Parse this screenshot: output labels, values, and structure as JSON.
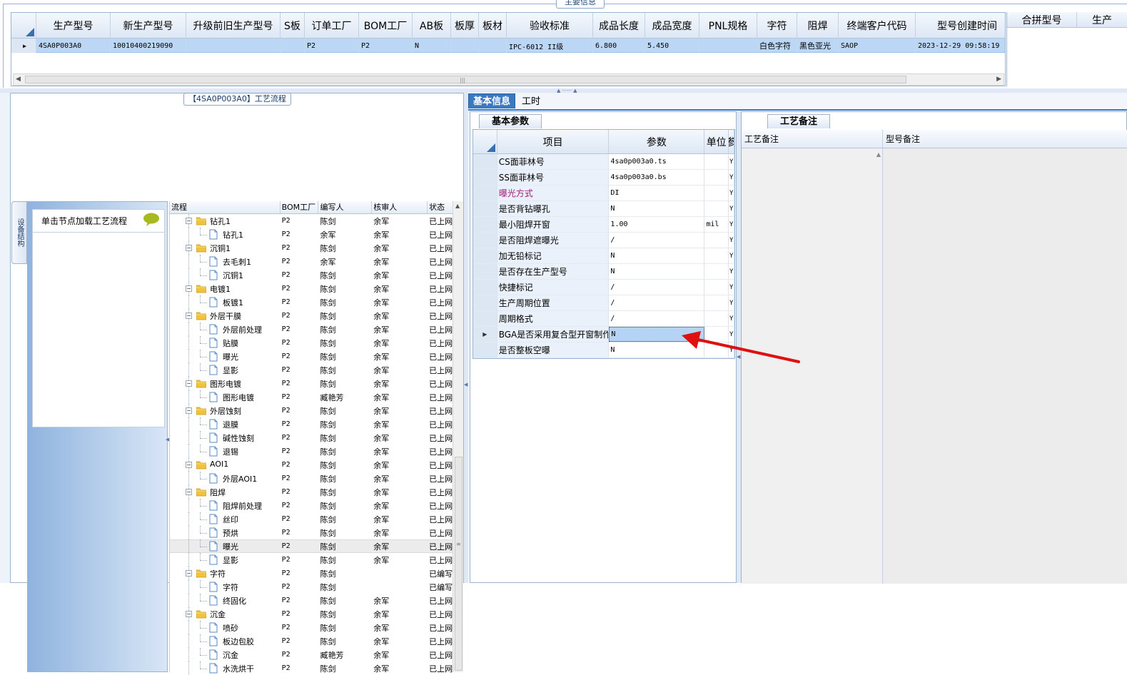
{
  "top": {
    "title": "主要信息",
    "columns": [
      "生产型号",
      "新生产型号",
      "升级前旧生产型号",
      "S板",
      "订单工厂",
      "BOM工厂",
      "AB板",
      "板厚",
      "板材",
      "验收标准",
      "成品长度",
      "成品宽度",
      "PNL规格",
      "字符",
      "阻焊",
      "终端客户代码",
      "型号创建时间"
    ],
    "row": [
      "4SA0P003A0",
      "10010400219090",
      "",
      "",
      "P2",
      "P2",
      "N",
      "",
      "",
      "IPC-6012 II级",
      "6.800",
      "5.450",
      "",
      "白色字符",
      "黑色亚光",
      "SAOP",
      "2023-12-29 09:58:19"
    ],
    "side_columns": [
      "合拼型号",
      "生产"
    ]
  },
  "process": {
    "title": "【4SA0P003A0】工艺流程",
    "vtab_label": "设备结构",
    "node_hint": "单击节点加载工艺流程",
    "headers": [
      "流程",
      "BOM工厂",
      "编写人",
      "核审人",
      "状态"
    ],
    "rows": [
      {
        "name": "钻孔1",
        "level": 0,
        "folder": true,
        "bom": "P2",
        "writer": "陈剑",
        "reviewer": "余军",
        "status": "已上网"
      },
      {
        "name": "钻孔1",
        "level": 1,
        "folder": false,
        "bom": "P2",
        "writer": "余军",
        "reviewer": "余军",
        "status": "已上网"
      },
      {
        "name": "沉铜1",
        "level": 0,
        "folder": true,
        "bom": "P2",
        "writer": "陈剑",
        "reviewer": "余军",
        "status": "已上网"
      },
      {
        "name": "去毛刺1",
        "level": 1,
        "folder": false,
        "bom": "P2",
        "writer": "余军",
        "reviewer": "余军",
        "status": "已上网"
      },
      {
        "name": "沉铜1",
        "level": 1,
        "folder": false,
        "bom": "P2",
        "writer": "陈剑",
        "reviewer": "余军",
        "status": "已上网"
      },
      {
        "name": "电镀1",
        "level": 0,
        "folder": true,
        "bom": "P2",
        "writer": "陈剑",
        "reviewer": "余军",
        "status": "已上网"
      },
      {
        "name": "板镀1",
        "level": 1,
        "folder": false,
        "bom": "P2",
        "writer": "陈剑",
        "reviewer": "余军",
        "status": "已上网"
      },
      {
        "name": "外层干膜",
        "level": 0,
        "folder": true,
        "bom": "P2",
        "writer": "陈剑",
        "reviewer": "余军",
        "status": "已上网"
      },
      {
        "name": "外层前处理",
        "level": 1,
        "folder": false,
        "bom": "P2",
        "writer": "陈剑",
        "reviewer": "余军",
        "status": "已上网"
      },
      {
        "name": "贴膜",
        "level": 1,
        "folder": false,
        "bom": "P2",
        "writer": "陈剑",
        "reviewer": "余军",
        "status": "已上网"
      },
      {
        "name": "曝光",
        "level": 1,
        "folder": false,
        "bom": "P2",
        "writer": "陈剑",
        "reviewer": "余军",
        "status": "已上网"
      },
      {
        "name": "显影",
        "level": 1,
        "folder": false,
        "bom": "P2",
        "writer": "陈剑",
        "reviewer": "余军",
        "status": "已上网"
      },
      {
        "name": "图形电镀",
        "level": 0,
        "folder": true,
        "bom": "P2",
        "writer": "陈剑",
        "reviewer": "余军",
        "status": "已上网"
      },
      {
        "name": "图形电镀",
        "level": 1,
        "folder": false,
        "bom": "P2",
        "writer": "臧艳芳",
        "reviewer": "余军",
        "status": "已上网"
      },
      {
        "name": "外层蚀刻",
        "level": 0,
        "folder": true,
        "bom": "P2",
        "writer": "陈剑",
        "reviewer": "余军",
        "status": "已上网"
      },
      {
        "name": "退膜",
        "level": 1,
        "folder": false,
        "bom": "P2",
        "writer": "陈剑",
        "reviewer": "余军",
        "status": "已上网"
      },
      {
        "name": "碱性蚀刻",
        "level": 1,
        "folder": false,
        "bom": "P2",
        "writer": "陈剑",
        "reviewer": "余军",
        "status": "已上网"
      },
      {
        "name": "退锡",
        "level": 1,
        "folder": false,
        "bom": "P2",
        "writer": "陈剑",
        "reviewer": "余军",
        "status": "已上网"
      },
      {
        "name": "AOI1",
        "level": 0,
        "folder": true,
        "bom": "P2",
        "writer": "陈剑",
        "reviewer": "余军",
        "status": "已上网"
      },
      {
        "name": "外层AOI1",
        "level": 1,
        "folder": false,
        "bom": "P2",
        "writer": "陈剑",
        "reviewer": "余军",
        "status": "已上网"
      },
      {
        "name": "阻焊",
        "level": 0,
        "folder": true,
        "bom": "P2",
        "writer": "陈剑",
        "reviewer": "余军",
        "status": "已上网"
      },
      {
        "name": "阻焊前处理",
        "level": 1,
        "folder": false,
        "bom": "P2",
        "writer": "陈剑",
        "reviewer": "余军",
        "status": "已上网"
      },
      {
        "name": "丝印",
        "level": 1,
        "folder": false,
        "bom": "P2",
        "writer": "陈剑",
        "reviewer": "余军",
        "status": "已上网"
      },
      {
        "name": "预烘",
        "level": 1,
        "folder": false,
        "bom": "P2",
        "writer": "陈剑",
        "reviewer": "余军",
        "status": "已上网"
      },
      {
        "name": "曝光",
        "level": 1,
        "folder": false,
        "bom": "P2",
        "writer": "陈剑",
        "reviewer": "余军",
        "status": "已上网",
        "selected": true
      },
      {
        "name": "显影",
        "level": 1,
        "folder": false,
        "bom": "P2",
        "writer": "陈剑",
        "reviewer": "余军",
        "status": "已上网"
      },
      {
        "name": "字符",
        "level": 0,
        "folder": true,
        "bom": "P2",
        "writer": "陈剑",
        "reviewer": "",
        "status": "已编写"
      },
      {
        "name": "字符",
        "level": 1,
        "folder": false,
        "bom": "P2",
        "writer": "陈剑",
        "reviewer": "",
        "status": "已编写"
      },
      {
        "name": "终固化",
        "level": 1,
        "folder": false,
        "bom": "P2",
        "writer": "陈剑",
        "reviewer": "余军",
        "status": "已上网"
      },
      {
        "name": "沉金",
        "level": 0,
        "folder": true,
        "bom": "P2",
        "writer": "陈剑",
        "reviewer": "余军",
        "status": "已上网"
      },
      {
        "name": "喷砂",
        "level": 1,
        "folder": false,
        "bom": "P2",
        "writer": "陈剑",
        "reviewer": "余军",
        "status": "已上网"
      },
      {
        "name": "板边包胶",
        "level": 1,
        "folder": false,
        "bom": "P2",
        "writer": "陈剑",
        "reviewer": "余军",
        "status": "已上网"
      },
      {
        "name": "沉金",
        "level": 1,
        "folder": false,
        "bom": "P2",
        "writer": "臧艳芳",
        "reviewer": "余军",
        "status": "已上网"
      },
      {
        "name": "水洗烘干",
        "level": 1,
        "folder": false,
        "bom": "P2",
        "writer": "陈剑",
        "reviewer": "余军",
        "status": "已上网"
      }
    ]
  },
  "tabs": [
    "基本信息",
    "工时"
  ],
  "basic": {
    "title": "基本参数",
    "headers": [
      "项目",
      "参数",
      "单位",
      "参"
    ],
    "rows": [
      {
        "item": "CS面菲林号",
        "value": "4sa0p003a0.ts",
        "unit": "",
        "flag": "Y"
      },
      {
        "item": "SS面菲林号",
        "value": "4sa0p003a0.bs",
        "unit": "",
        "flag": "Y"
      },
      {
        "item": "曝光方式",
        "value": "DI",
        "unit": "",
        "flag": "Y",
        "highlight": true
      },
      {
        "item": "是否背钻曝孔",
        "value": "N",
        "unit": "",
        "flag": "Y"
      },
      {
        "item": "最小阻焊开窗",
        "value": "1.00",
        "unit": "mil",
        "flag": "Y"
      },
      {
        "item": "是否阻焊遮曝光",
        "value": "/",
        "unit": "",
        "flag": "Y"
      },
      {
        "item": "加无铅标记",
        "value": "N",
        "unit": "",
        "flag": "Y"
      },
      {
        "item": "是否存在生产型号",
        "value": "N",
        "unit": "",
        "flag": "Y"
      },
      {
        "item": "快捷标记",
        "value": "/",
        "unit": "",
        "flag": "Y"
      },
      {
        "item": "生产周期位置",
        "value": "/",
        "unit": "",
        "flag": "Y"
      },
      {
        "item": "周期格式",
        "value": "/",
        "unit": "",
        "flag": "Y"
      },
      {
        "item": "BGA是否采用复合型开窗制作",
        "value": "N",
        "unit": "",
        "flag": "Y",
        "current": true
      },
      {
        "item": "是否整板空曝",
        "value": "N",
        "unit": "",
        "flag": "Y"
      }
    ]
  },
  "remark": {
    "title": "工艺备注",
    "headers": [
      "工艺备注",
      "型号备注"
    ]
  },
  "colors": {
    "accent": "#3a78c0",
    "selected_row": "#bcd7f5",
    "highlight_text": "#a0207a",
    "arrow": "#e01010"
  }
}
